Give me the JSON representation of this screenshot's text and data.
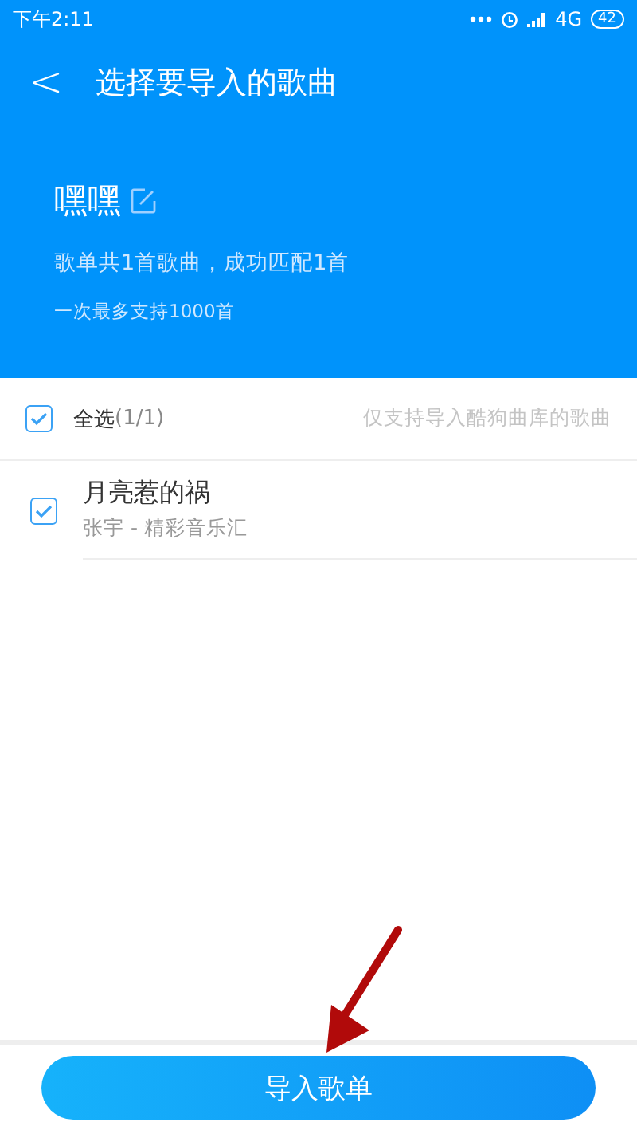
{
  "status_bar": {
    "time": "下午2:11",
    "network": "4G",
    "battery": "42"
  },
  "header": {
    "back": "<",
    "title": "选择要导入的歌曲"
  },
  "playlist": {
    "name": "嘿嘿",
    "summary": "歌单共1首歌曲，成功匹配1首",
    "limit": "一次最多支持1000首"
  },
  "select_all": {
    "label": "全选",
    "count": "(1/1)",
    "checked": true,
    "note": "仅支持导入酷狗曲库的歌曲"
  },
  "songs": [
    {
      "title": "月亮惹的祸",
      "subtitle": "张宇 - 精彩音乐汇",
      "checked": true
    }
  ],
  "import_button": {
    "label": "导入歌单"
  }
}
